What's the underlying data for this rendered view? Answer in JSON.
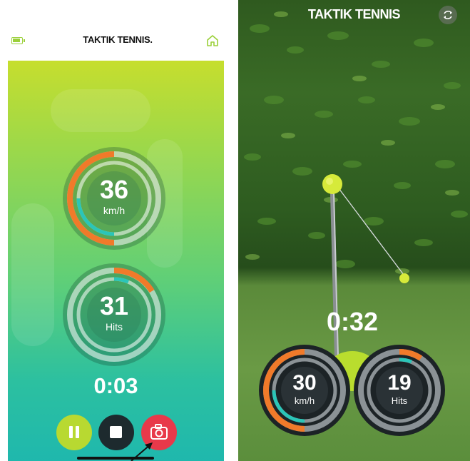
{
  "left": {
    "brand": "TAKTIK TENNIS.",
    "speed": {
      "value": "36",
      "unit": "km/h"
    },
    "hits": {
      "value": "31",
      "unit": "Hits"
    },
    "timer": "0:03",
    "icons": {
      "battery": "battery-icon",
      "home": "home-icon",
      "pause": "pause-icon",
      "stop": "stop-icon",
      "camera": "camera-icon"
    }
  },
  "right": {
    "brand": "TAKTIK TENNIS",
    "timer": "0:32",
    "speed": {
      "value": "30",
      "unit": "km/h"
    },
    "hits": {
      "value": "19",
      "unit": "Hits"
    },
    "icons": {
      "switch_camera": "switch-camera-icon"
    }
  },
  "colors": {
    "accent_green": "#b8d931",
    "orange": "#f07a2a",
    "teal": "#2bc5b8",
    "record_red": "#e8394a",
    "dark": "#1d2a2e"
  }
}
